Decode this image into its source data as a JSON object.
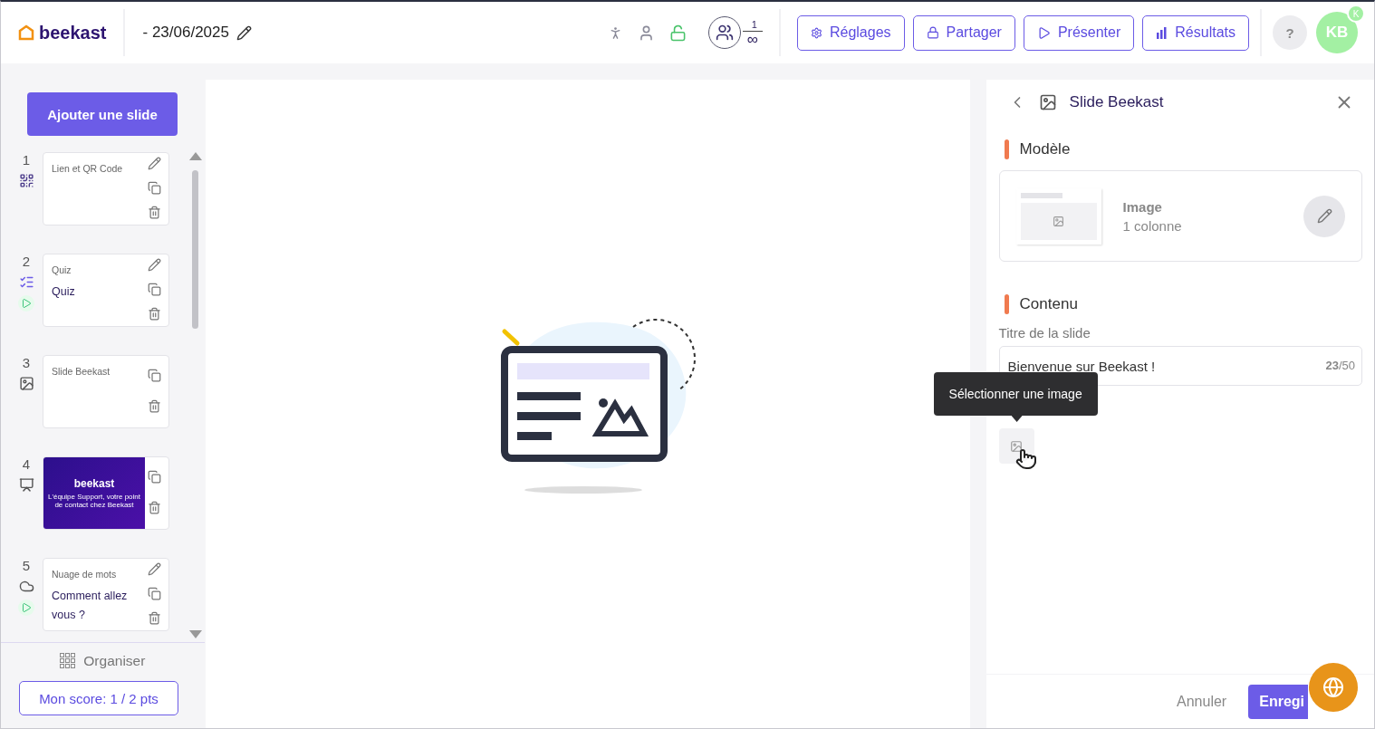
{
  "header": {
    "logo": "beekast",
    "date": "- 23/06/2025",
    "participants": {
      "current": "1",
      "max": "∞"
    },
    "buttons": [
      {
        "label": "Réglages",
        "kind": "settings"
      },
      {
        "label": "Partager",
        "kind": "share"
      },
      {
        "label": "Présenter",
        "kind": "present"
      },
      {
        "label": "Résultats",
        "kind": "results"
      }
    ],
    "help": "?",
    "avatar": {
      "initials": "KB",
      "badge": "K"
    }
  },
  "sidebar": {
    "add_button": "Ajouter une slide",
    "slides": [
      {
        "number": "1",
        "kind": "qr",
        "type_label": "Lien et QR Code",
        "editable": true,
        "playable": false
      },
      {
        "number": "2",
        "kind": "quiz",
        "type_label": "Quiz",
        "title": "Quiz",
        "editable": true,
        "playable": true
      },
      {
        "number": "3",
        "kind": "slide",
        "type_label": "Slide Beekast",
        "editable": false,
        "playable": false
      },
      {
        "number": "4",
        "kind": "cover",
        "cover_logo": "beekast",
        "cover_caption": "L'équipe Support, votre point de contact chez Beekast",
        "editable": false,
        "playable": false
      },
      {
        "number": "5",
        "kind": "wordcloud",
        "type_label": "Nuage de mots",
        "title": "Comment allez vous ?",
        "editable": true,
        "playable": true
      }
    ],
    "organize": "Organiser",
    "score": "Mon score: 1 / 2 pts"
  },
  "panel": {
    "title": "Slide Beekast",
    "sections": [
      {
        "title": "Modèle"
      },
      {
        "title": "Contenu"
      }
    ],
    "template": {
      "name": "Image",
      "detail": "1 colonne"
    },
    "field": {
      "label": "Titre de la slide",
      "value": "Bienvenue sur Beekast !",
      "counter": "**23**/50"
    },
    "tooltip": "Sélectionner une image",
    "footer": {
      "cancel": "Annuler",
      "save": "Enregi"
    }
  }
}
